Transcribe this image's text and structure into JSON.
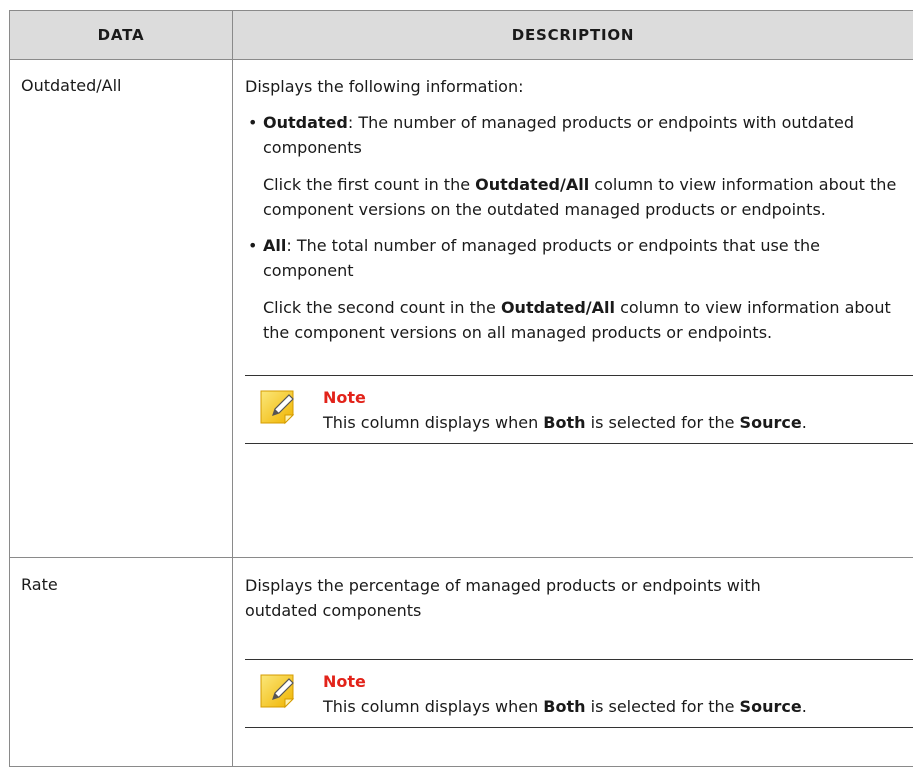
{
  "table": {
    "headers": [
      "Data",
      "Description"
    ],
    "rows": [
      {
        "data": "Outdated/All",
        "intro": "Displays the following information:",
        "bullets": [
          {
            "term": "Outdated",
            "text": ": The number of managed products or endpoints with outdated components",
            "sub_pre": "Click the first count in the ",
            "sub_bold": "Outdated/All",
            "sub_post": " column to view information about the component versions on the outdated managed products or endpoints."
          },
          {
            "term": "All",
            "text": ": The total number of managed products or endpoints that use the component",
            "sub_pre": "Click the second count in the ",
            "sub_bold": "Outdated/All",
            "sub_post": " column to view information about the component versions on all managed products or endpoints."
          }
        ],
        "note": {
          "title": "Note",
          "pre": "This column displays when ",
          "bold1": "Both",
          "mid": " is selected for the ",
          "bold2": "Source",
          "post": "."
        }
      },
      {
        "data": "Rate",
        "intro": "Displays the percentage of managed products or endpoints with outdated components",
        "note": {
          "title": "Note",
          "pre": "This column displays when ",
          "bold1": "Both",
          "mid": " is selected for the ",
          "bold2": "Source",
          "post": "."
        }
      }
    ]
  },
  "icons": {
    "note": "note-pencil-icon"
  },
  "colors": {
    "note_title": "#e2231a",
    "header_bg": "#dcdcdc",
    "icon_yellow": "#f5c518"
  }
}
